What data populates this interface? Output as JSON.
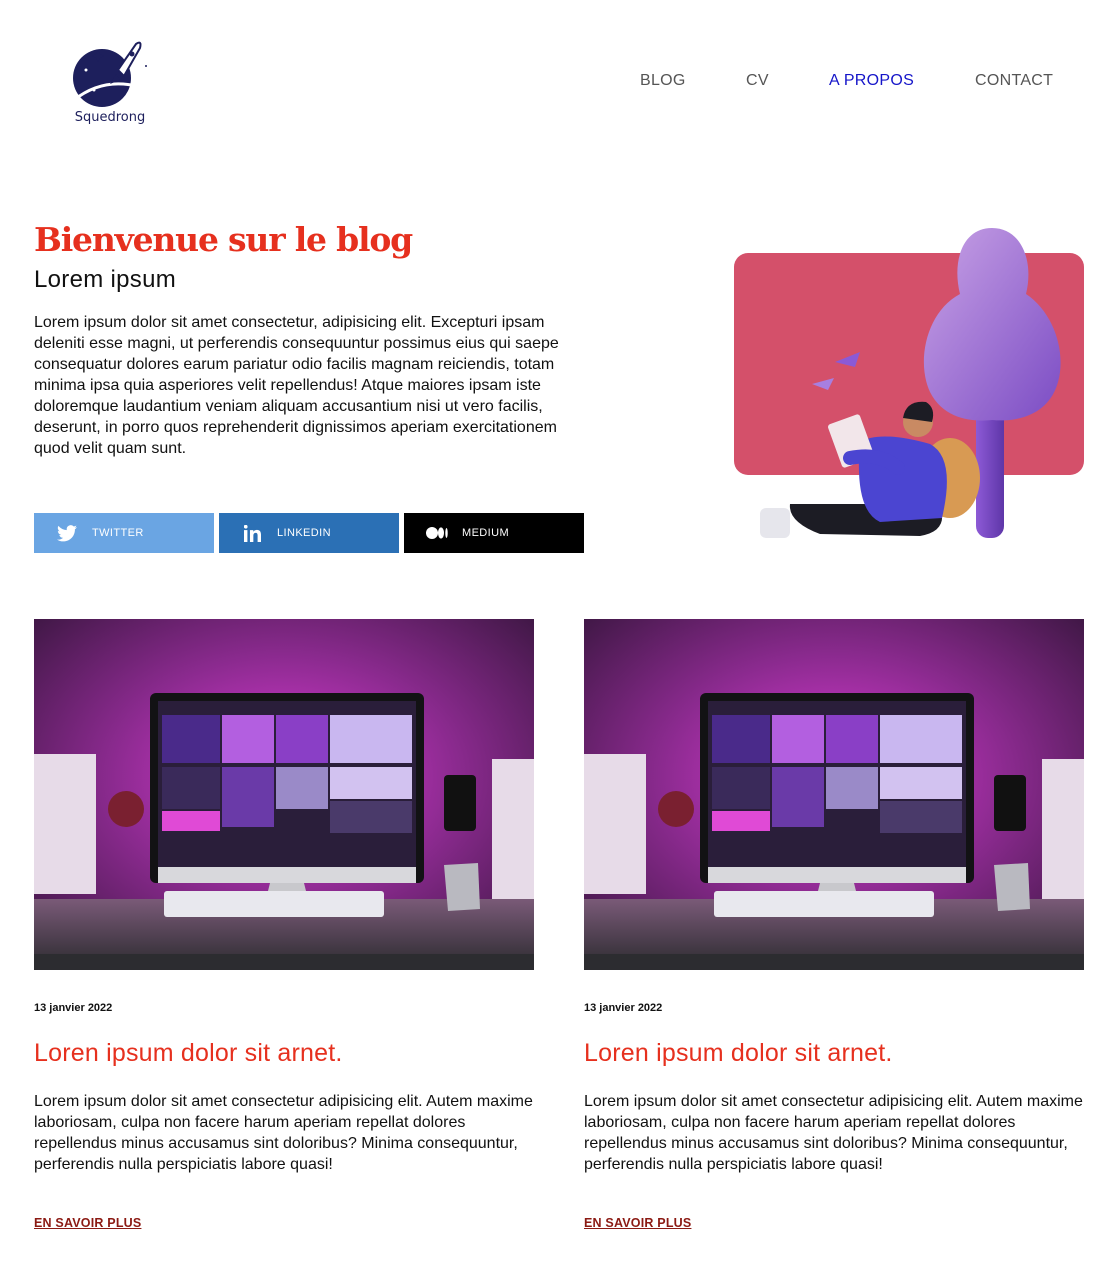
{
  "brand": {
    "name": "Squedrong"
  },
  "nav": {
    "items": [
      {
        "label": "BLOG"
      },
      {
        "label": "CV"
      },
      {
        "label": "A PROPOS"
      },
      {
        "label": "CONTACT"
      }
    ],
    "active": "A PROPOS"
  },
  "hero": {
    "title": "Bienvenue sur le blog",
    "subtitle": "Lorem ipsum",
    "text": "Lorem ipsum dolor sit amet consectetur, adipisicing elit. Excepturi ipsam deleniti esse magni, ut perferendis consequuntur possimus eius qui saepe consequatur dolores earum pariatur odio facilis magnam reiciendis, totam minima ipsa quia asperiores velit repellendus! Atque maiores ipsam iste doloremque laudantium veniam aliquam accusantium nisi ut vero facilis, deserunt, in porro quos reprehenderit dignissimos aperiam exercitationem quod velit quam sunt."
  },
  "social": {
    "twitter": {
      "label": "TWITTER",
      "icon": "twitter-icon",
      "color": "#6aa5e3"
    },
    "linkedin": {
      "label": "LINKEDIN",
      "icon": "linkedin-icon",
      "color": "#2b70b5"
    },
    "medium": {
      "label": "MEDIUM",
      "icon": "medium-icon",
      "color": "#000000"
    }
  },
  "posts": [
    {
      "date": "13 janvier 2022",
      "title": "Loren ipsum dolor sit arnet.",
      "excerpt": "Lorem ipsum dolor sit amet consectetur adipisicing elit. Autem maxime laboriosam, culpa non facere harum aperiam repellat dolores repellendus minus accusamus sint doloribus? Minima consequuntur, perferendis nulla perspiciatis labore quasi!",
      "link": "EN SAVOIR PLUS"
    },
    {
      "date": "13 janvier 2022",
      "title": "Loren ipsum dolor sit arnet.",
      "excerpt": "Lorem ipsum dolor sit amet consectetur adipisicing elit. Autem maxime laboriosam, culpa non facere harum aperiam repellat dolores repellendus minus accusamus sint doloribus? Minima consequuntur, perferendis nulla perspiciatis labore quasi!",
      "link": "EN SAVOIR PLUS"
    }
  ],
  "colors": {
    "accent": "#e6301e",
    "nav_active": "#1515c9",
    "link": "#8b1a13",
    "illustration_bg": "#d4506a"
  }
}
